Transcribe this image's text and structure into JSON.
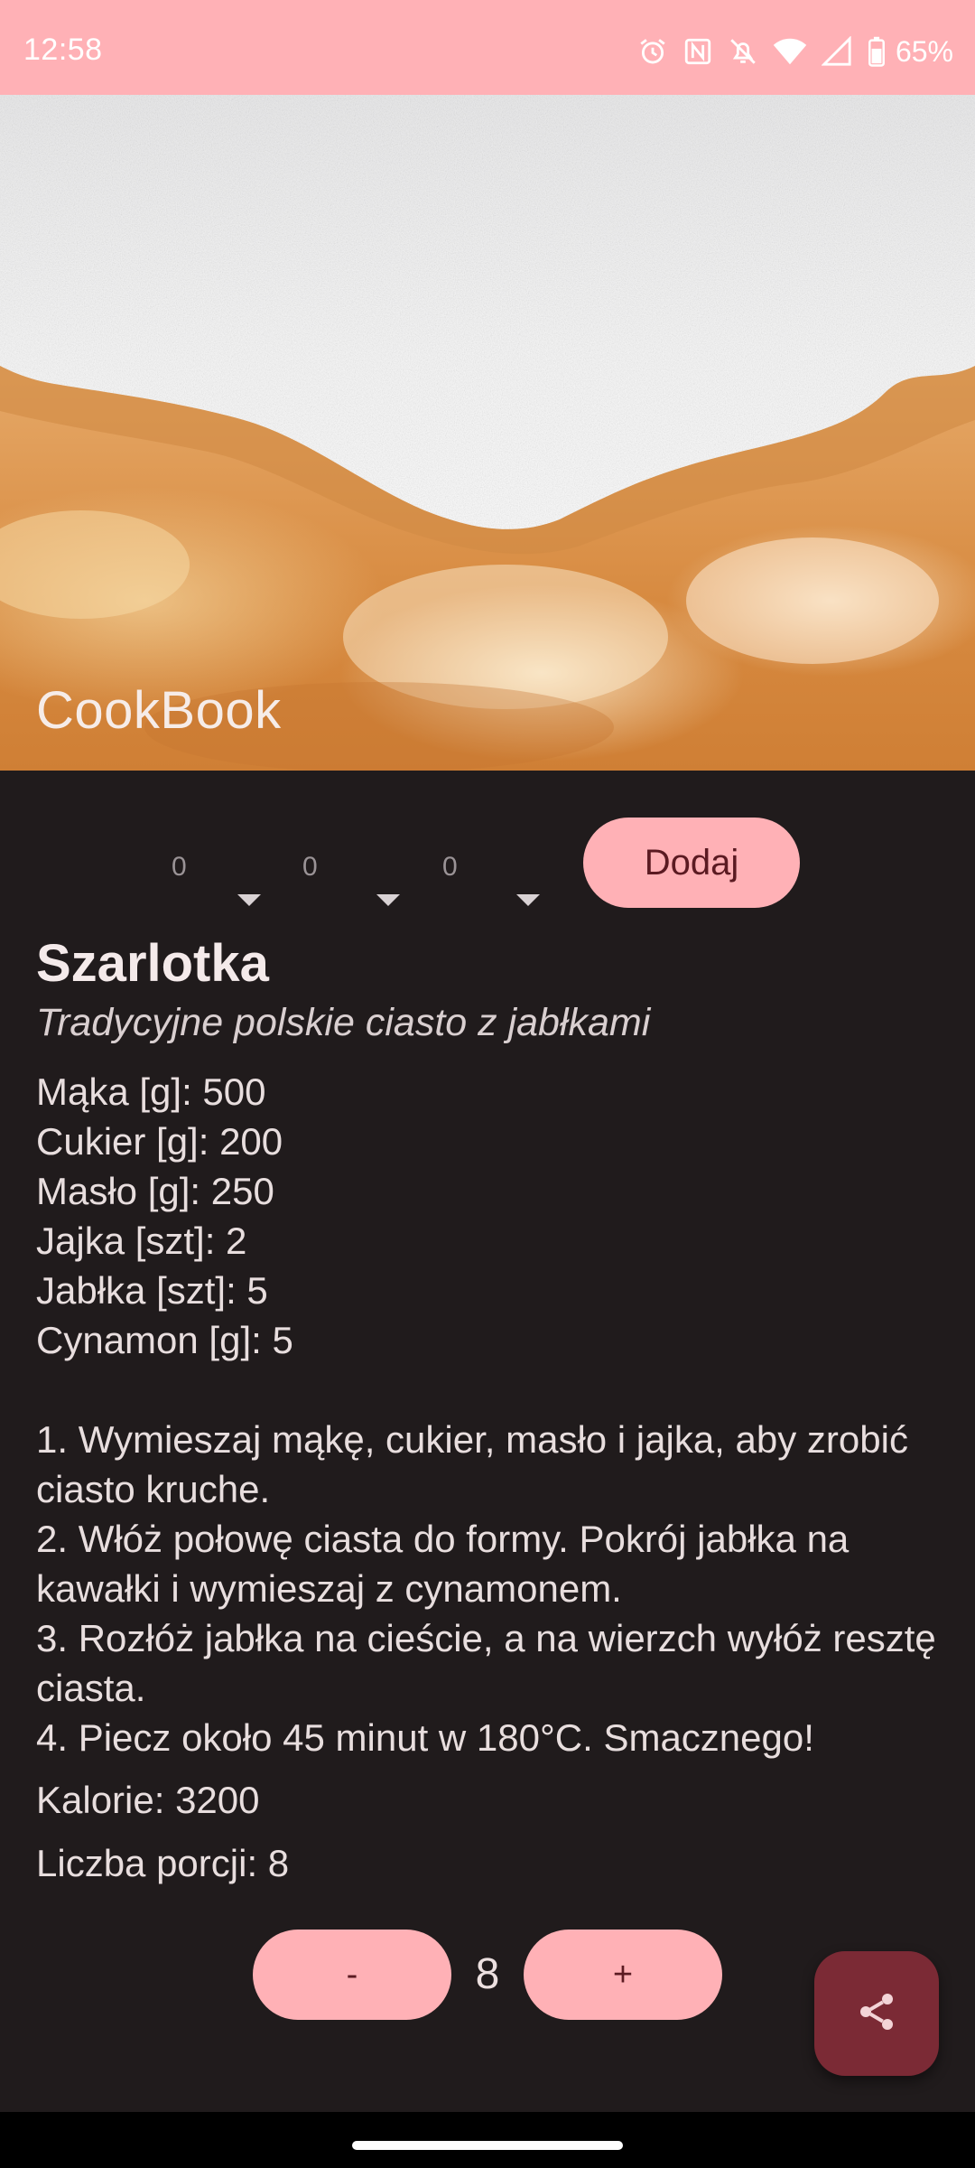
{
  "status_bar": {
    "time": "12:58",
    "battery_percent": "65%",
    "icons": [
      "alarm-icon",
      "nfc-icon",
      "mute-icon",
      "wifi-icon",
      "signal-icon",
      "battery-icon"
    ]
  },
  "header": {
    "app_title": "CookBook",
    "image": "powdered-sugar-cake-photo"
  },
  "controls": {
    "spinners": [
      "0",
      "0",
      "0"
    ],
    "add_label": "Dodaj"
  },
  "recipe": {
    "title": "Szarlotka",
    "subtitle": "Tradycyjne polskie ciasto z jabłkami",
    "ingredients": [
      "Mąka [g]: 500",
      "Cukier [g]: 200",
      "Masło [g]: 250",
      "Jajka [szt]: 2",
      "Jabłka [szt]: 5",
      "Cynamon [g]: 5"
    ],
    "steps": [
      "1. Wymieszaj mąkę, cukier, masło i jajka, aby zrobić ciasto kruche.",
      "2. Włóż połowę ciasta do formy. Pokrój jabłka na kawałki i wymieszaj z cynamonem.",
      "3. Rozłóż jabłka na cieście, a na wierzch wyłóż resztę ciasta.",
      "4. Piecz około 45 minut w 180°C. Smacznego!"
    ],
    "calories": "Kalorie: 3200",
    "servings_label": "Liczba porcji: 8"
  },
  "stepper": {
    "minus_label": "-",
    "value": "8",
    "plus_label": "+"
  },
  "fab": {
    "icon": "share-icon"
  },
  "colors": {
    "accent": "#ffb1b6",
    "on_accent": "#5b1a22",
    "background": "#201b1c",
    "fab": "#7b2a35"
  }
}
